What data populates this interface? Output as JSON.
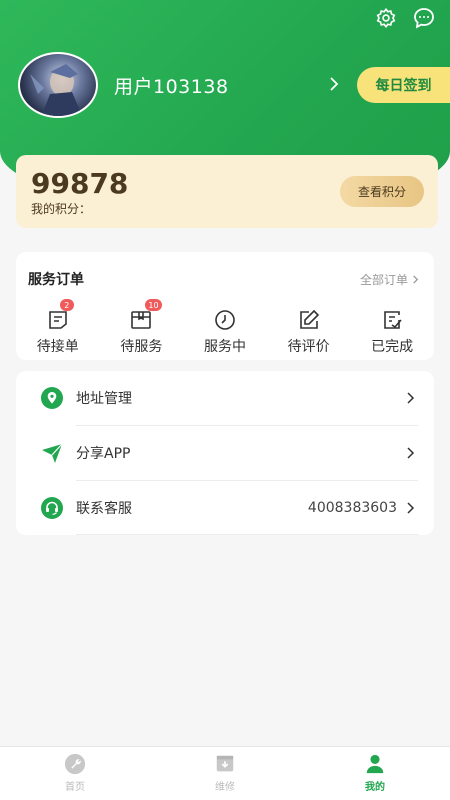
{
  "header": {
    "username": "用户103138",
    "checkin_label": "每日签到",
    "icons": [
      "settings-icon",
      "message-icon"
    ]
  },
  "points": {
    "value": "99878",
    "label": "我的积分：",
    "button_label": "查看积分"
  },
  "orders": {
    "title": "服务订单",
    "view_all": "全部订单",
    "items": [
      {
        "label": "待接单",
        "badge": "2",
        "icon": "pending-order-icon"
      },
      {
        "label": "待服务",
        "badge": "10",
        "icon": "service-box-icon"
      },
      {
        "label": "服务中",
        "badge": "",
        "icon": "clock-icon"
      },
      {
        "label": "待评价",
        "badge": "",
        "icon": "edit-review-icon"
      },
      {
        "label": "已完成",
        "badge": "",
        "icon": "completed-check-icon"
      }
    ]
  },
  "menu": {
    "items": [
      {
        "label": "地址管理",
        "value": "",
        "icon": "location-icon"
      },
      {
        "label": "分享APP",
        "value": "",
        "icon": "share-send-icon"
      },
      {
        "label": "联系客服",
        "value": "4008383603",
        "icon": "customer-service-icon"
      }
    ]
  },
  "tabbar": {
    "tabs": [
      {
        "label": "首页",
        "icon": "wrench-home-icon",
        "active": false
      },
      {
        "label": "维修",
        "icon": "repair-box-icon",
        "active": false
      },
      {
        "label": "我的",
        "icon": "person-icon",
        "active": true
      }
    ]
  },
  "colors": {
    "brand_green": "#22a64f",
    "checkin_yellow": "#f7e37a",
    "points_card_bg": "#fbefd4",
    "badge_red": "#ef5b5b"
  }
}
